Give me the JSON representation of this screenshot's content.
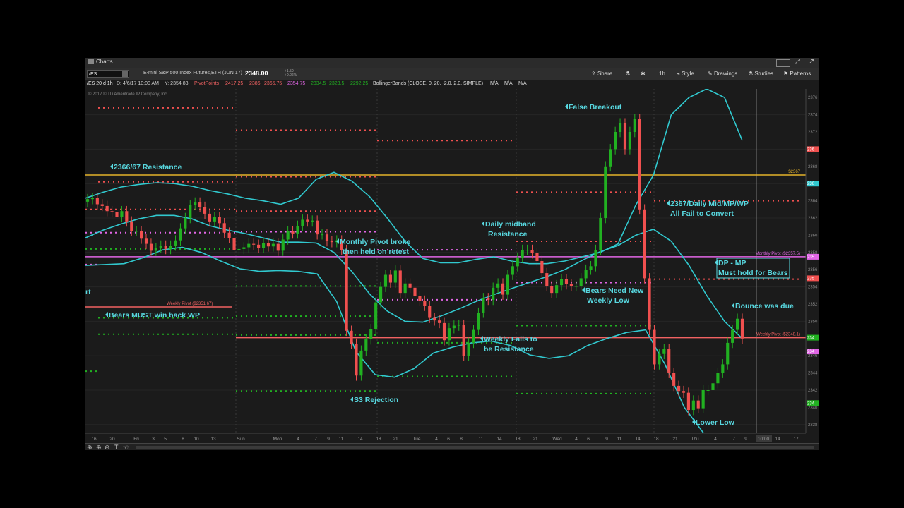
{
  "window": {
    "title": "Charts"
  },
  "toolbar": {
    "symbol": "/ES",
    "description": "E-mini S&P 500 Index Futures,ETH (JUN 17)",
    "price": "2348.00",
    "change_abs": "+1.50",
    "change_pct": "+0.06%",
    "share": "Share",
    "aggregation": "1h",
    "style": "Style",
    "drawings": "Drawings",
    "studies": "Studies",
    "patterns": "Patterns"
  },
  "study_header": {
    "period": "/ES 20 d 1h",
    "cursor": "D: 4/6/17 10:00 AM",
    "cursor_y": "Y: 2354.83",
    "pivot_label": "PivotPoints",
    "pivot_values": [
      "2417.25",
      "2386",
      "2365.75",
      "2354.75",
      "2334.5",
      "2323.5",
      "2292.25"
    ],
    "bb_label": "BollingerBands (CLOSE, 0, 20, -2.0, 2.0, SIMPLE)",
    "bb_values": [
      "N/A",
      "N/A",
      "N/A"
    ],
    "copyright": "© 2017 © TD Ameritrade IP Company, Inc."
  },
  "chart_data": {
    "type": "candlestick",
    "symbol": "/ES",
    "timeframe": "1h",
    "ylim": [
      2337,
      2377
    ],
    "y_ticks": [
      2338,
      2340,
      2342,
      2344,
      2346,
      2348,
      2350,
      2352,
      2354,
      2356,
      2358,
      2360,
      2362,
      2364,
      2366,
      2368,
      2370,
      2372,
      2374,
      2376
    ],
    "x_ticks": [
      "16",
      "20",
      "Fri",
      "3",
      "5",
      "8",
      "10",
      "13",
      "Sun",
      "Mon",
      "4",
      "7",
      "9",
      "11",
      "14",
      "18",
      "21",
      "Tue",
      "4",
      "6",
      "8",
      "11",
      "14",
      "18",
      "21",
      "Wed",
      "4",
      "6",
      "9",
      "11",
      "14",
      "18",
      "21",
      "Thu",
      "4",
      "7",
      "9",
      "10:00",
      "14",
      "17"
    ],
    "closes": [
      2364.2,
      2364.3,
      2363.6,
      2363.4,
      2362.8,
      2362.7,
      2362.1,
      2362.8,
      2361.6,
      2360.5,
      2360.5,
      2359.6,
      2359.0,
      2358.2,
      2358.5,
      2358.8,
      2358.4,
      2358.8,
      2359.4,
      2360.8,
      2362.0,
      2363.5,
      2363.8,
      2363.3,
      2362.5,
      2361.6,
      2362.1,
      2361.4,
      2360.3,
      2359.7,
      2358.3,
      2358.4,
      2358.6,
      2359.0,
      2358.9,
      2358.5,
      2359.1,
      2358.7,
      2359.0,
      2358.2,
      2359.5,
      2360.5,
      2360.2,
      2361.1,
      2361.8,
      2361.6,
      2361.7,
      2360.1,
      2360.1,
      2359.3,
      2359.2,
      2359.4,
      2358.3,
      2348.9,
      2347.4,
      2343.7,
      2346.6,
      2347.9,
      2349.1,
      2352.2,
      2354.0,
      2355.4,
      2354.5,
      2355.9,
      2353.3,
      2354.4,
      2353.9,
      2352.9,
      2352.4,
      2351.8,
      2350.4,
      2350.1,
      2349.8,
      2347.8,
      2349.2,
      2349.5,
      2349.6,
      2346.0,
      2347.5,
      2349.0,
      2351.0,
      2352.7,
      2352.5,
      2353.9,
      2354.4,
      2353.1,
      2355.4,
      2356.4,
      2357.4,
      2358.3,
      2358.3,
      2357.9,
      2357.0,
      2355.6,
      2354.1,
      2353.3,
      2354.2,
      2354.9,
      2354.3,
      2354.1,
      2354.1,
      2355.0,
      2356.0,
      2356.4,
      2358.3,
      2362.0,
      2368.0,
      2370.0,
      2372.0,
      2373.0,
      2370.0,
      2372.0,
      2373.5,
      2363.0,
      2355.0,
      2349.0,
      2345.0,
      2346.2,
      2346.8,
      2344.0,
      2342.5,
      2341.9,
      2341.7,
      2339.7,
      2340.8,
      2339.9,
      2342.0,
      2342.0,
      2342.8,
      2344.0,
      2345.0,
      2347.5,
      2349.0,
      2350.3,
      2348.0
    ],
    "bollinger": {
      "upper": [
        2364.3,
        2365.0,
        2365.6,
        2365.9,
        2366.1,
        2366.0,
        2365.7,
        2365.2,
        2364.8,
        2364.3,
        2364.0,
        2363.6,
        2364.3,
        2366.5,
        2367.3,
        2366.3,
        2364.5,
        2362.0,
        2359.3,
        2357.3,
        2356.8,
        2356.8,
        2357.2,
        2357.5,
        2357.0,
        2356.7,
        2356.7,
        2357.0,
        2357.5,
        2358.0,
        2359.0,
        2363.5,
        2367.0,
        2374.0,
        2376.0,
        2377.0,
        2376.0,
        2371.0
      ],
      "middle": [
        2359.7,
        2360.6,
        2361.3,
        2361.9,
        2362.3,
        2362.3,
        2361.9,
        2361.1,
        2360.6,
        2360.2,
        2359.7,
        2359.2,
        2359.2,
        2359.1,
        2358.0,
        2355.8,
        2353.2,
        2351.2,
        2350.0,
        2349.9,
        2350.6,
        2351.4,
        2352.3,
        2353.1,
        2353.8,
        2354.5,
        2355.2,
        2356.0,
        2357.1,
        2358.1,
        2358.8,
        2360.0,
        2360.7,
        2359.3,
        2356.5,
        2353.0,
        2350.0,
        2348.0
      ],
      "lower": [
        2356.5,
        2356.6,
        2356.7,
        2357.4,
        2358.3,
        2358.6,
        2358.0,
        2357.0,
        2356.1,
        2355.8,
        2355.9,
        2355.8,
        2355.5,
        2352.3,
        2346.5,
        2343.8,
        2343.5,
        2344.5,
        2346.3,
        2347.0,
        2347.5,
        2347.7,
        2347.2,
        2346.1,
        2345.7,
        2346.0,
        2347.2,
        2348.0,
        2348.7,
        2349.0,
        2345.0,
        2340.0,
        2337.0,
        2337.0,
        2337.0
      ]
    },
    "levels": [
      {
        "name": "2367 line",
        "value": "$2367"
      },
      {
        "name": "Monthly Pivot",
        "value": "Monthly Pivot ($2357.5)"
      },
      {
        "name": "Weekly Pivot",
        "value": "Weekly Pivot ($2348.1)"
      },
      {
        "name": "Weekly Pivot (previous week)",
        "value": "Weekly Pivot ($2351.67)"
      }
    ],
    "annotations": [
      "2366/67 Resistance",
      "Bears MUST win back WP",
      "rt",
      "Monthly Pivot broke",
      "then held on retest",
      "S3 Rejection",
      "Daily midband",
      "Resistance",
      "Weekly Fails to",
      "be Resistance",
      "False Breakout",
      "Bears Need New",
      "Weekly Low",
      "2367/Daily Mid/MP/WP",
      "All Fail to Convert",
      "DP - MP",
      "Must hold for Bears",
      "Bounce was due",
      "Lower Low"
    ],
    "right_axis_tags": [
      "236",
      "236",
      "235",
      "235",
      "234",
      "234",
      "234"
    ],
    "cursor_x_label": "10:00",
    "colors": {
      "up": "#21b121",
      "down": "#f0504f",
      "band": "#31c9cf",
      "level_2367": "#e4b32a",
      "monthly_pivot": "#e266e6",
      "weekly_pivot": "#f26262",
      "annotation": "#58d8e0"
    }
  }
}
